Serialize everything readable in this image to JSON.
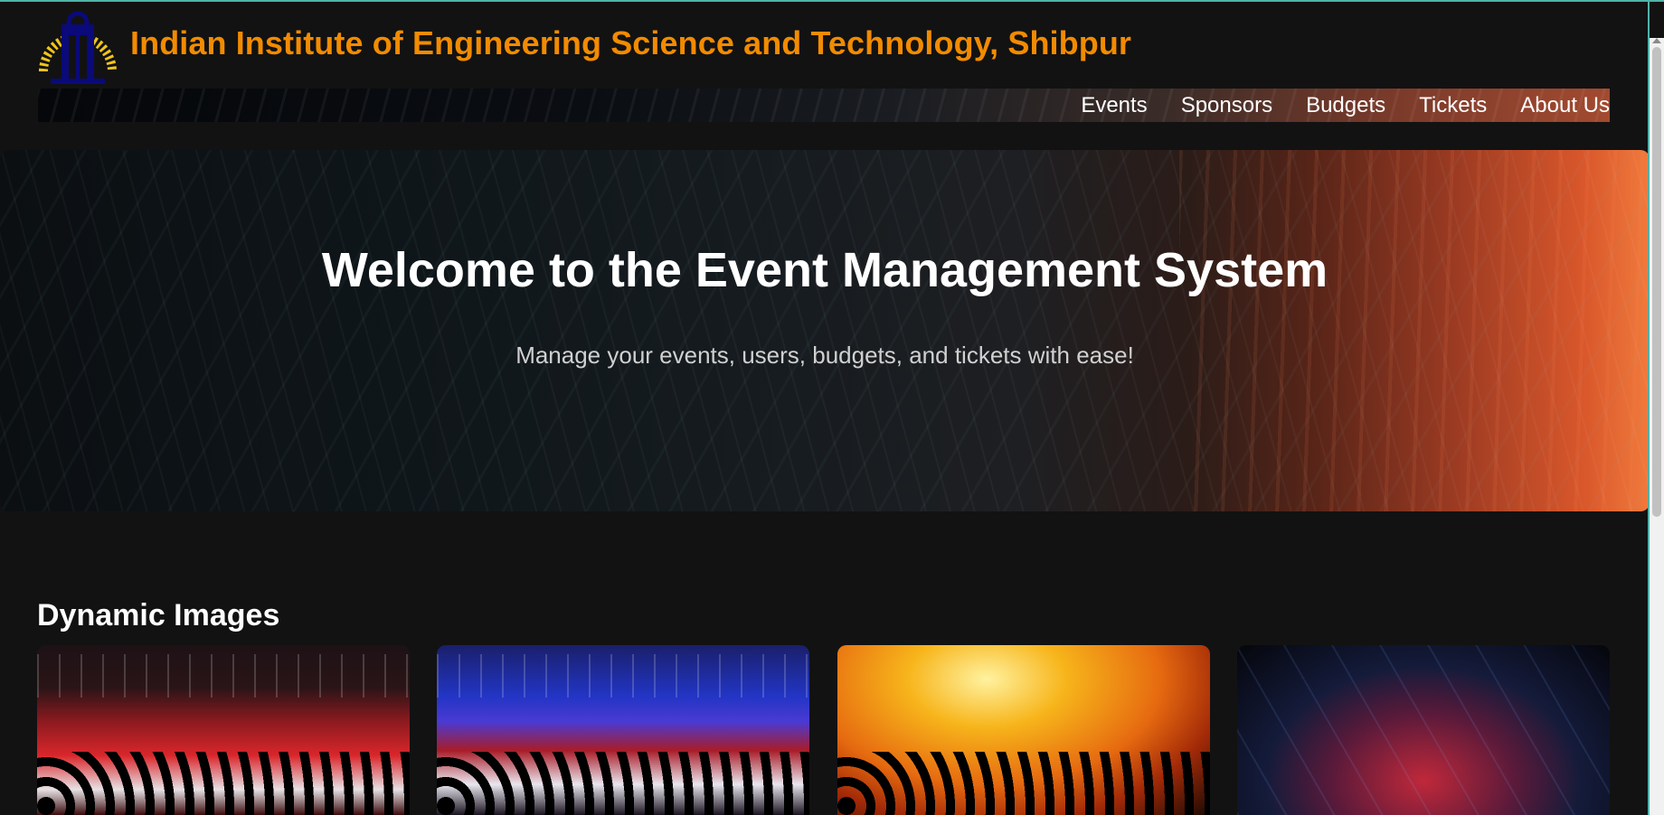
{
  "site": {
    "title": "Indian Institute of Engineering Science and Technology, Shibpur",
    "logo_icon": "iiest-logo-icon"
  },
  "nav": {
    "items": [
      {
        "label": "Events"
      },
      {
        "label": "Sponsors"
      },
      {
        "label": "Budgets"
      },
      {
        "label": "Tickets"
      },
      {
        "label": "About Us"
      }
    ]
  },
  "hero": {
    "title": "Welcome to the Event Management System",
    "subtitle": "Manage your events, users, budgets, and tickets with ease!"
  },
  "gallery": {
    "title": "Dynamic Images",
    "images": [
      {
        "name": "concert-image-1"
      },
      {
        "name": "concert-image-2"
      },
      {
        "name": "concert-image-3"
      },
      {
        "name": "concert-image-4"
      }
    ]
  },
  "colors": {
    "background": "#121212",
    "title_orange": "#f28b00",
    "text": "#ffffff",
    "subtitle": "#d0d0d0"
  }
}
